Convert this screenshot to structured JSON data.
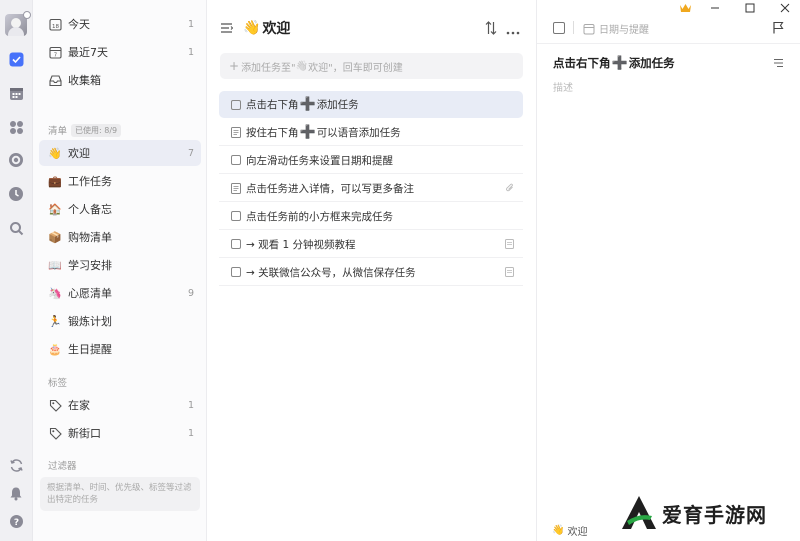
{
  "rail": {
    "icons": [
      "avatar",
      "check-square-icon",
      "calendar-icon",
      "grid-icon",
      "target-icon",
      "clock-icon",
      "search-icon"
    ],
    "bottom_icons": [
      "sync-icon",
      "bell-icon",
      "help-icon"
    ]
  },
  "sidebar": {
    "smart_lists": [
      {
        "label": "今天",
        "count": "1",
        "icon": "calendar-day-icon"
      },
      {
        "label": "最近7天",
        "count": "1",
        "icon": "calendar-week-icon"
      },
      {
        "label": "收集箱",
        "count": "",
        "icon": "inbox-icon"
      }
    ],
    "lists_header": "清单",
    "lists_badge": "已使用: 8/9",
    "lists": [
      {
        "label": "欢迎",
        "count": "7",
        "emoji": "👋",
        "active": true
      },
      {
        "label": "工作任务",
        "count": "",
        "emoji": "💼"
      },
      {
        "label": "个人备忘",
        "count": "",
        "emoji": "🏠"
      },
      {
        "label": "购物清单",
        "count": "",
        "emoji": "📦"
      },
      {
        "label": "学习安排",
        "count": "",
        "emoji": "📖"
      },
      {
        "label": "心愿清单",
        "count": "9",
        "emoji": "🦄"
      },
      {
        "label": "锻炼计划",
        "count": "",
        "emoji": "🏃"
      },
      {
        "label": "生日提醒",
        "count": "",
        "emoji": "🎂"
      }
    ],
    "tags_header": "标签",
    "tags": [
      {
        "label": "在家",
        "count": "1"
      },
      {
        "label": "新街口",
        "count": "1"
      }
    ],
    "filters_header": "过滤器",
    "filters_hint": "根据清单、时间、优先级、标签等过滤出特定的任务"
  },
  "main": {
    "title_emoji": "👋",
    "title": "欢迎",
    "add_prefix": "添加任务至\"",
    "add_emoji": "👋",
    "add_suffix": "欢迎\"，回车即可创建",
    "tasks": [
      {
        "pre": "点击右下角",
        "plus": "➕",
        "post": "添加任务",
        "kind": "checkbox",
        "active": true,
        "trail": ""
      },
      {
        "pre": "按住右下角",
        "plus": "➕",
        "post": "可以语音添加任务",
        "kind": "note",
        "trail": ""
      },
      {
        "pre": "向左滑动任务来设置日期和提醒",
        "plus": "",
        "post": "",
        "kind": "checkbox",
        "trail": ""
      },
      {
        "pre": "点击任务进入详情，可以写更多备注",
        "plus": "",
        "post": "",
        "kind": "note",
        "trail": "clip"
      },
      {
        "pre": "点击任务前的小方框来完成任务",
        "plus": "",
        "post": "",
        "kind": "checkbox",
        "trail": ""
      },
      {
        "pre": "→ 观看 1 分钟视频教程",
        "plus": "",
        "post": "",
        "kind": "checkbox",
        "trail": "note"
      },
      {
        "pre": "→ 关联微信公众号，从微信保存任务",
        "plus": "",
        "post": "",
        "kind": "checkbox",
        "trail": "note"
      }
    ]
  },
  "detail": {
    "date_placeholder": "日期与提醒",
    "title_pre": "点击右下角",
    "title_plus": "➕",
    "title_post": "添加任务",
    "desc_placeholder": "描述",
    "footer_emoji": "👋",
    "footer_list": "欢迎"
  },
  "brand": {
    "text": "爱育手游网"
  },
  "colors": {
    "accent": "#4772fa",
    "plus": "#7b57d8",
    "crown": "#f0a81e",
    "brand_green": "#2aa845"
  }
}
